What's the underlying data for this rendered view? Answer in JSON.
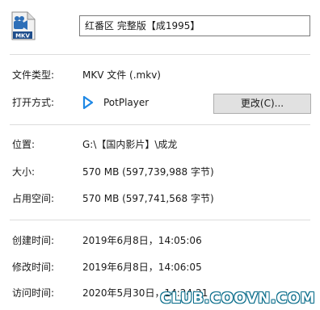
{
  "header": {
    "file_icon": "mkv-file-icon",
    "file_icon_label": "MKV",
    "file_name": "红番区 完整版【成1995】"
  },
  "fields": {
    "type_label": "文件类型:",
    "type_value": "MKV 文件 (.mkv)",
    "opens_with_label": "打开方式:",
    "opens_with_icon": "potplayer-play-icon",
    "opens_with_value": "PotPlayer",
    "change_button": "更改(C)...",
    "location_label": "位置:",
    "location_value": "G:\\【国内影片】\\成龙",
    "size_label": "大小:",
    "size_value": "570 MB (597,739,988 字节)",
    "size_on_disk_label": "占用空间:",
    "size_on_disk_value": "570 MB (597,741,568 字节)",
    "created_label": "创建时间:",
    "created_value": "2019年6月8日，14:05:06",
    "modified_label": "修改时间:",
    "modified_value": "2019年6月8日，14:06:05",
    "accessed_label": "访问时间:",
    "accessed_value": "2020年5月30日，14:24:21"
  },
  "watermark": "CLUB.COOVN.COM",
  "colors": {
    "separator": "#dcdcdc",
    "button_bg": "#e1e1e1",
    "accent_blue": "#1e88e5"
  }
}
